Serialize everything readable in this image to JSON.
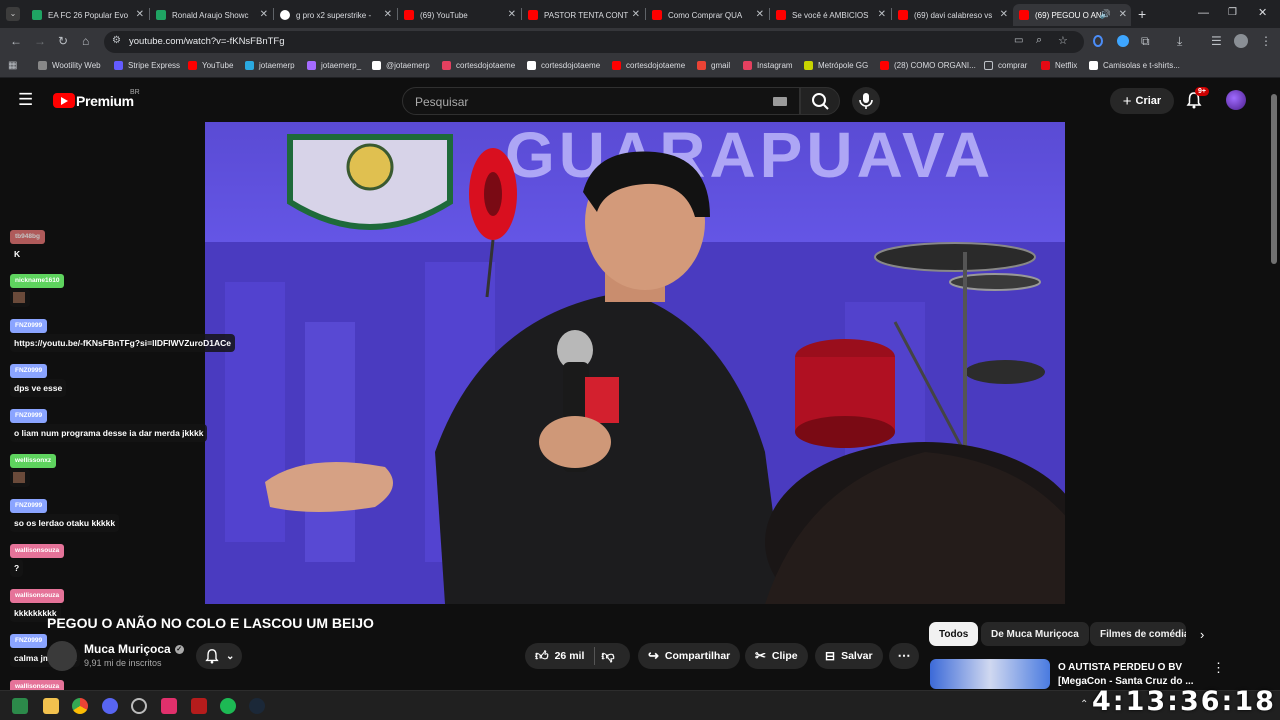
{
  "browser": {
    "tabs": [
      {
        "title": "EA FC 26 Popular Evo",
        "color": "#1fa463"
      },
      {
        "title": "Ronald Araujo Showc",
        "color": "#1fa463"
      },
      {
        "title": "g pro x2 superstrike -",
        "color": "#ffffff"
      },
      {
        "title": "(69) YouTube",
        "color": "#ff0000"
      },
      {
        "title": "PASTOR TENTA CONT",
        "color": "#ff0000"
      },
      {
        "title": "Como Comprar QUA",
        "color": "#ff0000"
      },
      {
        "title": "Se você é AMBICIOS",
        "color": "#ff0000"
      },
      {
        "title": "(69) davi calabreso vs",
        "color": "#ff0000"
      },
      {
        "title": "(69) PEGOU O AN",
        "color": "#ff0000"
      }
    ],
    "url": "youtube.com/watch?v=-fKNsFBnTFg",
    "bookmarks": [
      {
        "label": "Wootility Web",
        "color": "#888888"
      },
      {
        "label": "Stripe Express",
        "color": "#635bff"
      },
      {
        "label": "YouTube",
        "color": "#ff0000"
      },
      {
        "label": "jotaemerp",
        "color": "#2aa9e0"
      },
      {
        "label": "jotaemerp_",
        "color": "#a56bff"
      },
      {
        "label": "@jotaemerp",
        "color": "#ffffff"
      },
      {
        "label": "cortesdojotaeme",
        "color": "#e4405f"
      },
      {
        "label": "cortesdojotaeme",
        "color": "#ffffff"
      },
      {
        "label": "cortesdojotaeme",
        "color": "#ff0000"
      },
      {
        "label": "gmail",
        "color": "#ea4335"
      },
      {
        "label": "Instagram",
        "color": "#e4405f"
      },
      {
        "label": "Metrópole GG",
        "color": "#c7d400"
      },
      {
        "label": "(28) COMO ORGANI...",
        "color": "#ff0000"
      },
      {
        "label": "comprar",
        "color": "#bdc1c6"
      },
      {
        "label": "Netflix",
        "color": "#e50914"
      },
      {
        "label": "Camisolas e t-shirts...",
        "color": "#ffffff"
      }
    ]
  },
  "youtube": {
    "logo_text": "Premium",
    "logo_region": "BR",
    "search_placeholder": "Pesquisar",
    "create_label": "Criar",
    "notifications_badge": "9+",
    "video_title": "PEGOU O ANÃO NO COLO E LASCOU UM BEIJO",
    "channel_name": "Muca Muriçoca",
    "subscribers": "9,91 mi de inscritos",
    "likes": "26 mil",
    "share_label": "Compartilhar",
    "clip_label": "Clipe",
    "save_label": "Salvar",
    "chips": [
      "Todos",
      "De Muca Muriçoca",
      "Filmes de comédia"
    ],
    "recommended": {
      "title_line1": "O AUTISTA PERDEU O BV",
      "title_line2": "[MegaCon - Santa Cruz do ..."
    }
  },
  "chat": [
    {
      "user": "tb948bg",
      "text": "K",
      "color": "#e57373"
    },
    {
      "user": "nickname1610",
      "text": "",
      "color": "#5ed35e",
      "emote": true
    },
    {
      "user": "FNZ0999",
      "text": "https://youtu.be/-fKNsFBnTFg?si=lIDFIWVZuroD1ACe",
      "color": "#8aa4ff"
    },
    {
      "user": "FNZ0999",
      "text": "dps ve esse",
      "color": "#8aa4ff"
    },
    {
      "user": "FNZ0999",
      "text": "o liam num programa desse ia dar merda jkkkk",
      "color": "#8aa4ff"
    },
    {
      "user": "wellissonxz",
      "text": "",
      "color": "#5ed35e",
      "emote": true
    },
    {
      "user": "FNZ0999",
      "text": "so os lerdao otaku kkkkk",
      "color": "#8aa4ff"
    },
    {
      "user": "wallisonsouza",
      "text": "?",
      "color": "#e57399"
    },
    {
      "user": "wallisonsouza",
      "text": "kkkkkkkkk",
      "color": "#e57399"
    },
    {
      "user": "FNZ0999",
      "text": "calma jm kkkkk",
      "color": "#8aa4ff"
    },
    {
      "user": "wallisonsouza",
      "text": "",
      "color": "#e57399"
    }
  ],
  "overlay_clock": "4:13:36:18"
}
